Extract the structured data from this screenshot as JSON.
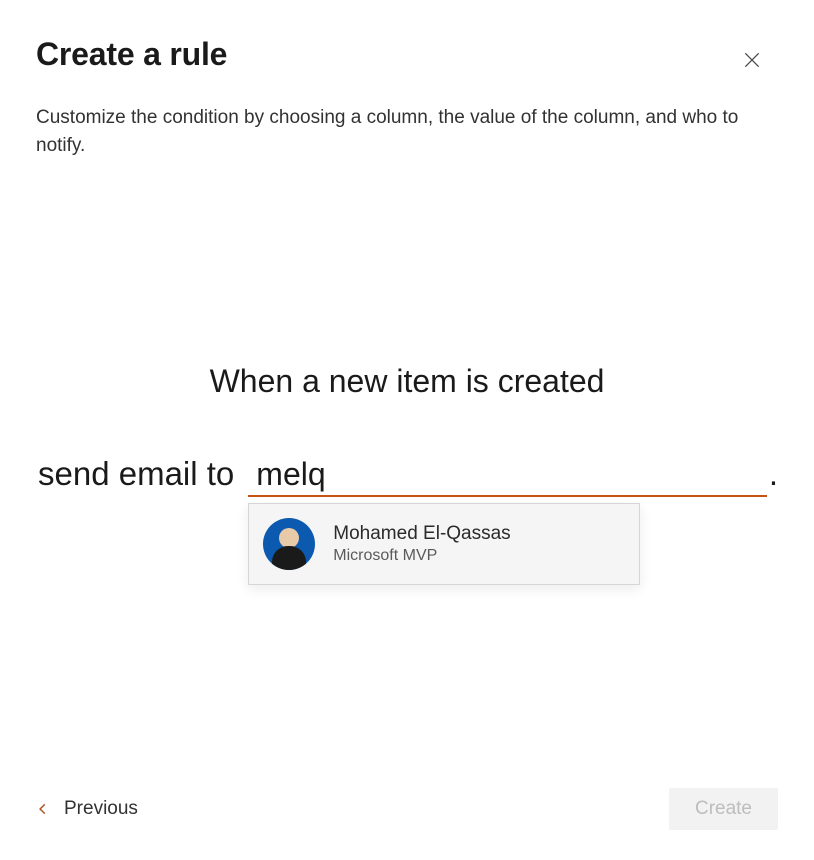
{
  "dialog": {
    "title": "Create a rule",
    "description": "Customize the condition by choosing a column, the value of the column, and who to notify."
  },
  "rule": {
    "condition": "When a new item is created",
    "action_prefix": "send email to",
    "input_value": "melq",
    "period": "."
  },
  "suggestion": {
    "name": "Mohamed El-Qassas",
    "subtitle": "Microsoft MVP"
  },
  "footer": {
    "previous_label": "Previous",
    "create_label": "Create"
  }
}
